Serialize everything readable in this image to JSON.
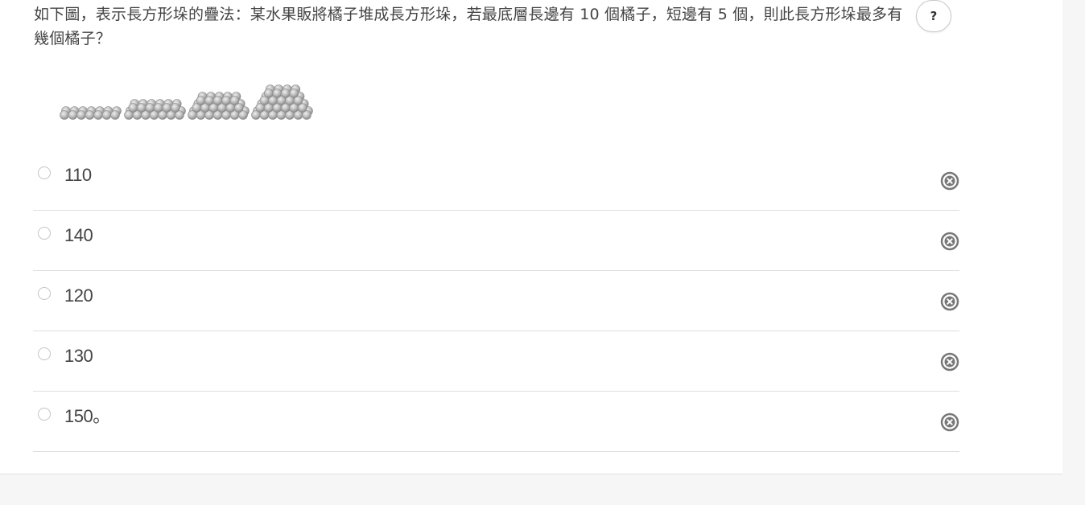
{
  "question": {
    "text": "如下圖，表示長方形垛的疊法：某水果販將橘子堆成長方形垛，若最底層長邊有 10 個橘子，短邊有 5 個，則此長方形垛最多有幾個橘子？"
  },
  "help": {
    "label": "?"
  },
  "options": [
    {
      "label": "110"
    },
    {
      "label": "140"
    },
    {
      "label": "120"
    },
    {
      "label": "130"
    },
    {
      "label": "150。"
    }
  ],
  "icons": {
    "strike": "circle-x-icon",
    "help": "question-icon",
    "illustration": "orange-stack-image"
  },
  "colors": {
    "page_bg": "#f6f6f6",
    "card_bg": "#ffffff",
    "divider": "#dedede",
    "icon_gray": "#777777"
  }
}
